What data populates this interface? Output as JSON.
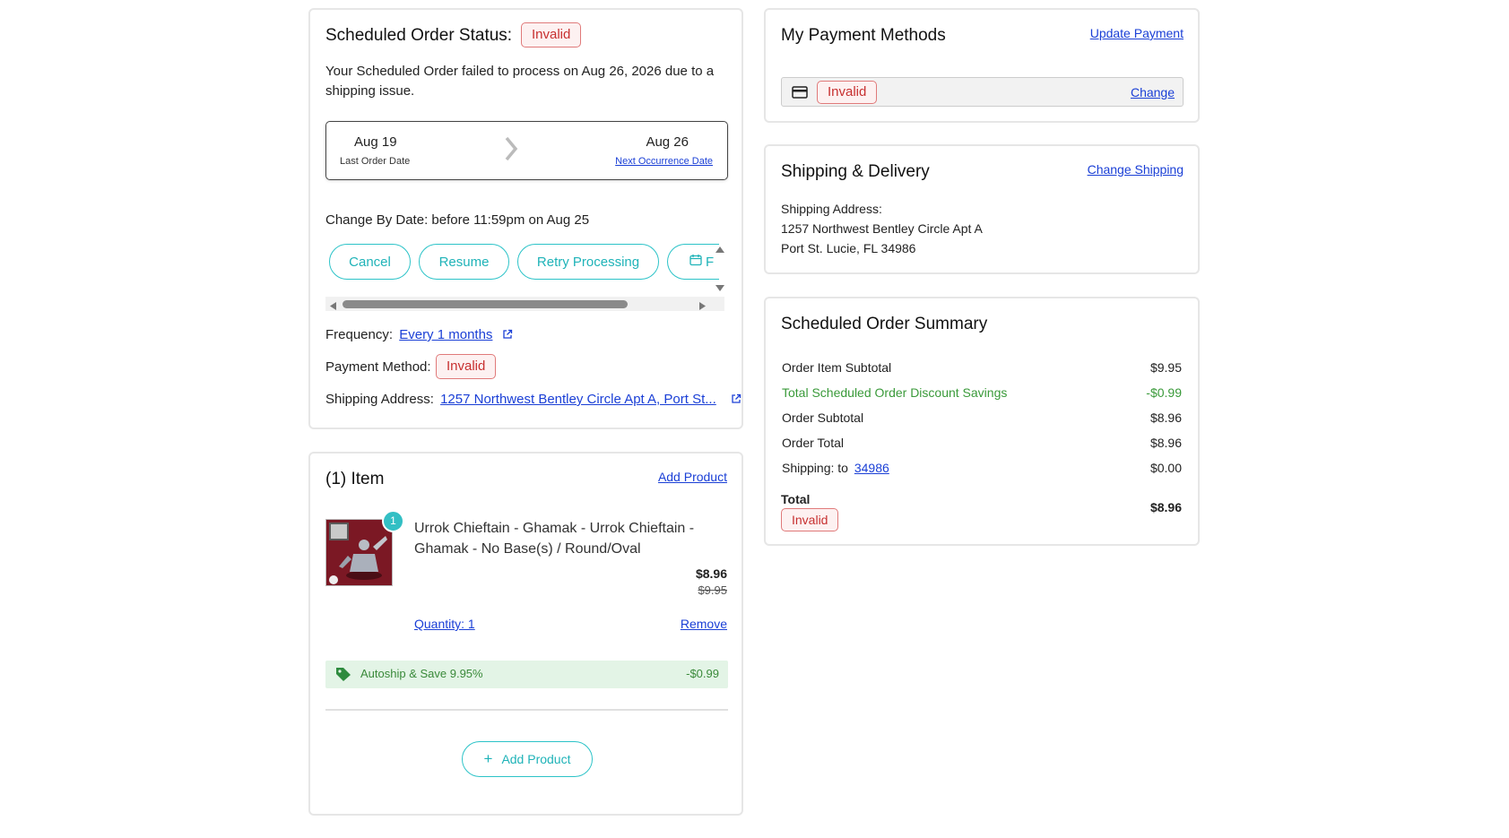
{
  "status_card": {
    "title": "Scheduled Order Status:",
    "status_badge": "Invalid",
    "message": "Your Scheduled Order failed to process on Aug 26, 2026 due to a shipping issue.",
    "last_date": "Aug 19",
    "last_label": "Last Order Date",
    "next_date": "Aug 26",
    "next_label": "Next Occurrence Date",
    "change_by": "Change By Date: before 11:59pm on Aug 25",
    "actions": {
      "cancel": "Cancel",
      "resume": "Resume",
      "retry": "Retry Processing",
      "partial": "F"
    },
    "frequency_label": "Frequency:",
    "frequency_value": "Every 1 months",
    "payment_label": "Payment Method:",
    "payment_badge": "Invalid",
    "shipping_label": "Shipping Address:",
    "shipping_value": "1257 Northwest Bentley Circle Apt A, Port St..."
  },
  "items_card": {
    "title": "(1) Item",
    "add_product_link": "Add Product",
    "item": {
      "count_badge": "1",
      "name": "Urrok Chieftain - Ghamak - Urrok Chieftain - Ghamak - No Base(s) / Round/Oval",
      "price": "$8.96",
      "original_price": "$9.95",
      "quantity": "Quantity: 1",
      "remove": "Remove"
    },
    "discount_label": "Autoship & Save 9.95%",
    "discount_value": "-$0.99",
    "add_product_button": "Add Product"
  },
  "payment_card": {
    "title": "My Payment Methods",
    "update_link": "Update Payment",
    "badge": "Invalid",
    "change_link": "Change"
  },
  "shipping_card": {
    "title": "Shipping & Delivery",
    "change_link": "Change Shipping",
    "address_label": "Shipping Address:",
    "line1": "1257 Northwest Bentley Circle Apt A",
    "line2": "Port St. Lucie, FL 34986"
  },
  "summary_card": {
    "title": "Scheduled Order Summary",
    "rows": [
      {
        "label": "Order Item Subtotal",
        "value": "$9.95"
      },
      {
        "label": "Total Scheduled Order Discount Savings",
        "value": "-$0.99"
      },
      {
        "label": "Order Subtotal",
        "value": "$8.96"
      },
      {
        "label": "Order Total",
        "value": "$8.96"
      }
    ],
    "shipping_label": "Shipping: to",
    "shipping_zip": "34986",
    "shipping_value": "$0.00",
    "total_label": "Total",
    "total_badge": "Invalid",
    "total_value": "$8.96"
  },
  "colors": {
    "accent_teal": "#2cc3c8",
    "link_blue": "#1a3fd6",
    "invalid_red": "#c73030",
    "discount_green": "#3a9a3a"
  }
}
